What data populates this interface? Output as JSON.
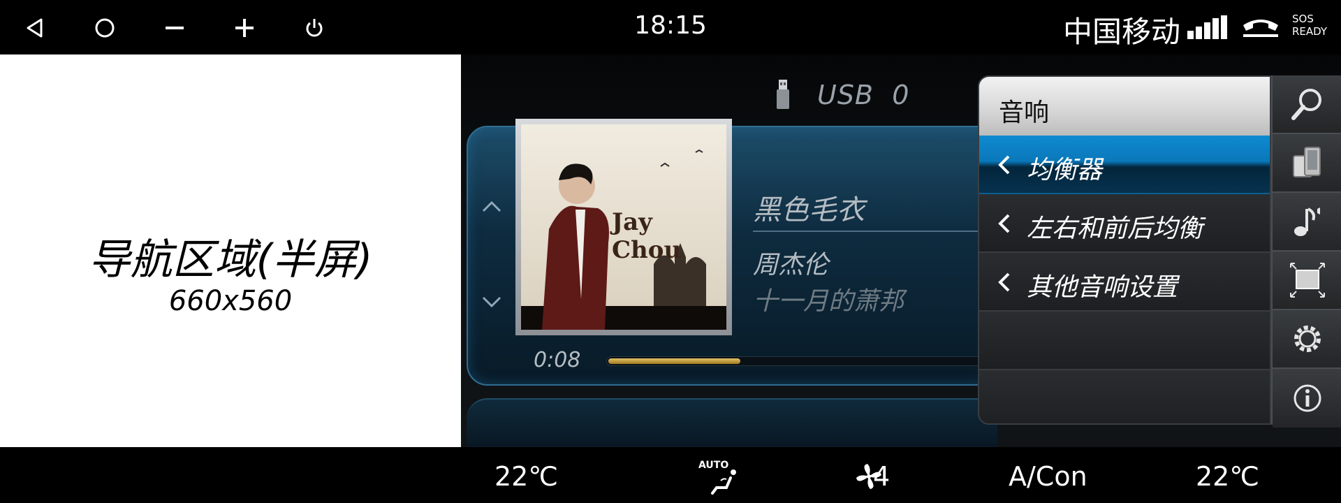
{
  "status_bar": {
    "time": "18:15",
    "carrier": "中国移动",
    "sos_line1": "SOS",
    "sos_line2": "READY",
    "icons": [
      "back-triangle-icon",
      "home-circle-icon",
      "volume-down-icon",
      "volume-up-icon",
      "power-icon",
      "signal-bars-icon",
      "phone-hangup-icon"
    ]
  },
  "navigation": {
    "title": "导航区域(半屏)",
    "size_label": "660x560"
  },
  "media": {
    "source": "USB",
    "source_index": "0",
    "song": "黑色毛衣",
    "artist": "周杰伦",
    "album": "十一月的萧邦",
    "elapsed": "0:08",
    "progress_fraction": 0.34,
    "album_art_text": "Jay Chou",
    "colors": {
      "progress": "#d4aa3c",
      "card_border": "#2f6e92"
    }
  },
  "audio_menu": {
    "title": "音响",
    "items": [
      {
        "label": "均衡器",
        "active": true
      },
      {
        "label": "左右和前后均衡",
        "active": false
      },
      {
        "label": "其他音响设置",
        "active": false
      }
    ]
  },
  "toolbar": {
    "buttons": [
      "search-icon",
      "phone-link-icon",
      "music-note-icon",
      "screen-fullscreen-icon",
      "gear-icon",
      "info-icon"
    ]
  },
  "climate": {
    "temp_left": "22℃",
    "auto_label": "AUTO",
    "fan_level": "4",
    "ac_label": "A/Con",
    "temp_right": "22℃"
  }
}
